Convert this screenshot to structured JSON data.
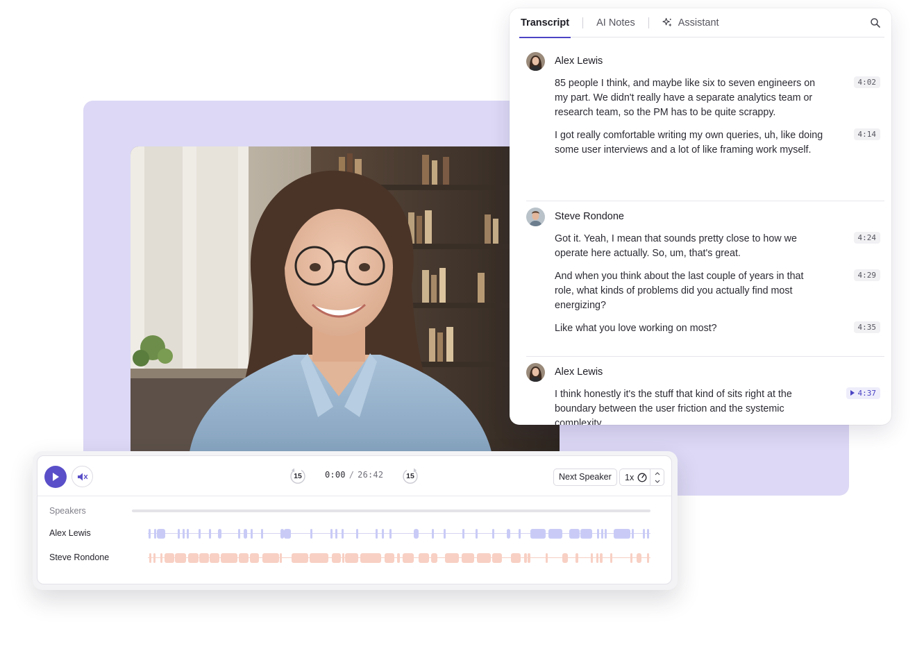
{
  "colors": {
    "accent": "#5a4fc8",
    "lavender": "#dcd8f5",
    "alex_track": "#c9cbf6",
    "steve_track": "#f8d0c4"
  },
  "tabs": [
    {
      "label": "Transcript",
      "active": true
    },
    {
      "label": "AI Notes",
      "active": false
    },
    {
      "label": "Assistant",
      "active": false,
      "icon": "sparkle-icon"
    }
  ],
  "transcript": [
    {
      "speaker": "Alex Lewis",
      "utterances": [
        {
          "text": "85 people I think, and maybe like six to seven engineers on my part. We didn't really have a separate analytics team or research team, so the PM has to be quite scrappy.",
          "time": "4:02"
        },
        {
          "text": "I got really comfortable writing my own queries, uh, like doing some user interviews and a lot of like framing work myself.",
          "time": "4:14"
        }
      ]
    },
    {
      "speaker": "Steve Rondone",
      "utterances": [
        {
          "text": "Got it. Yeah, I mean that sounds pretty close to how we operate here actually. So, um, that's great.",
          "time": "4:24"
        },
        {
          "text": "And when you think about the last couple of years in that role, what kinds of problems did you actually find most energizing?",
          "time": "4:29"
        },
        {
          "text": "Like what you love working on most?",
          "time": "4:35"
        }
      ]
    },
    {
      "speaker": "Alex Lewis",
      "utterances": [
        {
          "text": "I think honestly it's the stuff that kind of sits right at the boundary between the user friction and the systemic complexity",
          "time": "4:37",
          "playing": true
        }
      ]
    }
  ],
  "player": {
    "current_time": "0:00",
    "duration": "26:42",
    "skip_back": "15",
    "skip_forward": "15",
    "next_speaker": "Next Speaker",
    "speed": "1x",
    "speakers_heading": "Speakers",
    "speakers": [
      {
        "name": "Alex Lewis",
        "color": "#c9cbf6"
      },
      {
        "name": "Steve Rondone",
        "color": "#f8d0c4"
      }
    ]
  }
}
